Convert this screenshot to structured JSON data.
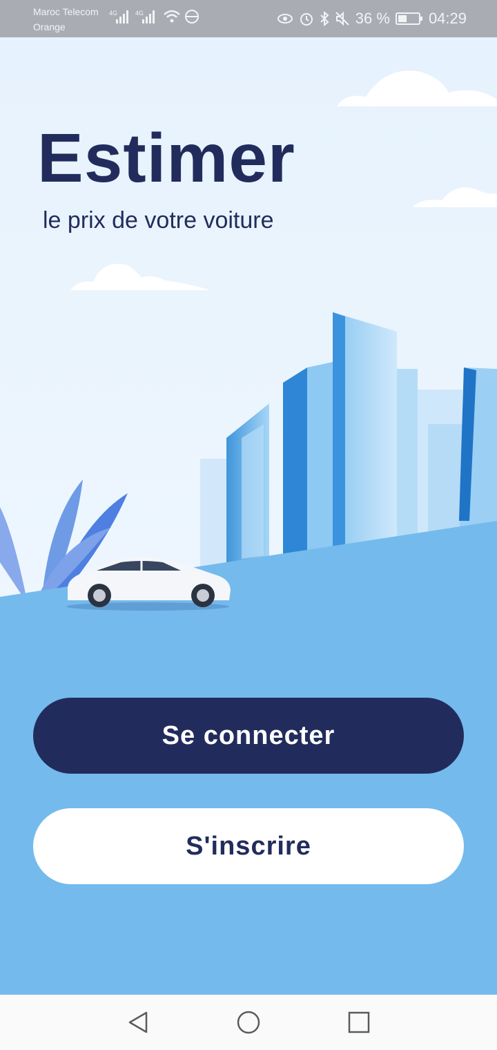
{
  "status_bar": {
    "carrier_1": "Maroc Telecom",
    "carrier_2": "Orange",
    "network_1": "4G",
    "network_2": "4G",
    "battery": "36 %",
    "time": "04:29"
  },
  "hero": {
    "title": "Estimer",
    "subtitle": "le prix de votre voiture"
  },
  "actions": {
    "login_label": "Se connecter",
    "register_label": "S'inscrire"
  },
  "nav_bar": {
    "icons": [
      "back-icon",
      "home-icon",
      "recents-icon"
    ]
  },
  "colors": {
    "primary": "#222c5c",
    "ground": "#74baed",
    "sky": "#e9f3fd"
  }
}
